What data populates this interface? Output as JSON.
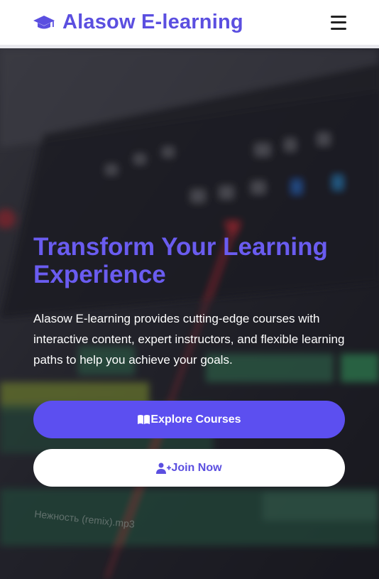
{
  "navbar": {
    "brand": "Alasow E-learning",
    "brand_icon": "graduation-cap-icon",
    "menu_icon": "hamburger-menu-icon"
  },
  "hero": {
    "title": "Transform Your Learning Experience",
    "description": "Alasow E-learning provides cutting-edge courses with interactive content, expert instructors, and flexible learning paths to help you achieve your goals.",
    "primary_button": {
      "label": "Explore Courses",
      "icon": "book-open-icon"
    },
    "secondary_button": {
      "label": "Join Now",
      "icon": "user-plus-icon"
    },
    "background_timeline_clip": "Нежность (remix).mp3"
  },
  "colors": {
    "brand": "#5b4fe0",
    "primary_button": "#5c4ff0",
    "title": "#6a5cf0"
  }
}
